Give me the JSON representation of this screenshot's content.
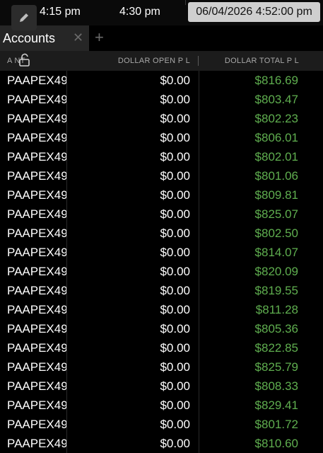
{
  "timebar": {
    "ticks": [
      "4:15 pm",
      "4:30 pm"
    ],
    "clock": "06/04/2026 4:52:00 pm",
    "edit_icon": "pencil-icon"
  },
  "tabs": [
    {
      "label": "Accounts",
      "active": true,
      "close_icon": "close-icon"
    }
  ],
  "add_tab_icon": "plus-icon",
  "table": {
    "lock_icon": "lock-open-icon",
    "columns": [
      {
        "key": "account",
        "label": "A      NT"
      },
      {
        "key": "open",
        "label": "DOLLAR OPEN P L"
      },
      {
        "key": "total",
        "label": "DOLLAR TOTAL P L"
      }
    ],
    "rows": [
      {
        "account": "PAAPEX49",
        "open": "$0.00",
        "total": "$816.69"
      },
      {
        "account": "PAAPEX49",
        "open": "$0.00",
        "total": "$803.47"
      },
      {
        "account": "PAAPEX49",
        "open": "$0.00",
        "total": "$802.23"
      },
      {
        "account": "PAAPEX49",
        "open": "$0.00",
        "total": "$806.01"
      },
      {
        "account": "PAAPEX49",
        "open": "$0.00",
        "total": "$802.01"
      },
      {
        "account": "PAAPEX49",
        "open": "$0.00",
        "total": "$801.06"
      },
      {
        "account": "PAAPEX49",
        "open": "$0.00",
        "total": "$809.81"
      },
      {
        "account": "PAAPEX49",
        "open": "$0.00",
        "total": "$825.07"
      },
      {
        "account": "PAAPEX49",
        "open": "$0.00",
        "total": "$802.50"
      },
      {
        "account": "PAAPEX49",
        "open": "$0.00",
        "total": "$814.07"
      },
      {
        "account": "PAAPEX49",
        "open": "$0.00",
        "total": "$820.09"
      },
      {
        "account": "PAAPEX49",
        "open": "$0.00",
        "total": "$819.55"
      },
      {
        "account": "PAAPEX49",
        "open": "$0.00",
        "total": "$811.28"
      },
      {
        "account": "PAAPEX49",
        "open": "$0.00",
        "total": "$805.36"
      },
      {
        "account": "PAAPEX49",
        "open": "$0.00",
        "total": "$822.85"
      },
      {
        "account": "PAAPEX49",
        "open": "$0.00",
        "total": "$825.79"
      },
      {
        "account": "PAAPEX49",
        "open": "$0.00",
        "total": "$808.33"
      },
      {
        "account": "PAAPEX49",
        "open": "$0.00",
        "total": "$829.41"
      },
      {
        "account": "PAAPEX49",
        "open": "$0.00",
        "total": "$801.72"
      },
      {
        "account": "PAAPEX49",
        "open": "$0.00",
        "total": "$810.60"
      }
    ]
  },
  "colors": {
    "background": "#000000",
    "header_bg": "#1c1c1c",
    "tab_bg": "#262626",
    "profit_green": "#5fae4f",
    "clock_bg": "#cfcfcf"
  }
}
